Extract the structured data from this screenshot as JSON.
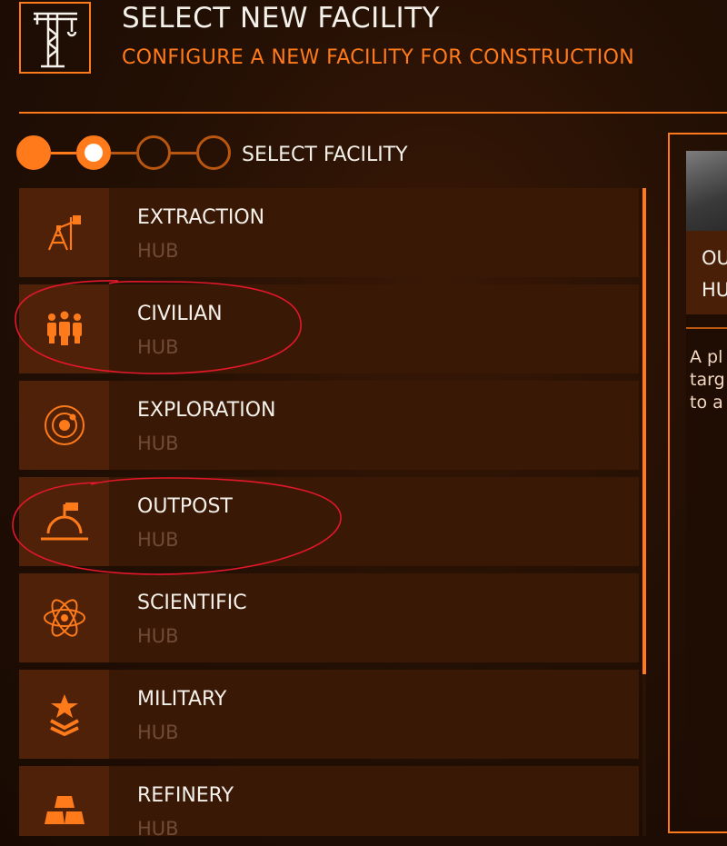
{
  "header": {
    "title": "SELECT NEW FACILITY",
    "subtitle": "CONFIGURE A NEW FACILITY FOR CONSTRUCTION",
    "icon": "construction-crane-icon"
  },
  "steps": {
    "label": "SELECT FACILITY",
    "total": 4,
    "current": 2
  },
  "facilities": [
    {
      "name": "EXTRACTION",
      "type": "HUB",
      "icon": "oil-pump-icon"
    },
    {
      "name": "CIVILIAN",
      "type": "HUB",
      "icon": "people-icon"
    },
    {
      "name": "EXPLORATION",
      "type": "HUB",
      "icon": "orbit-icon"
    },
    {
      "name": "OUTPOST",
      "type": "HUB",
      "icon": "flag-dome-icon"
    },
    {
      "name": "SCIENTIFIC",
      "type": "HUB",
      "icon": "atom-icon"
    },
    {
      "name": "MILITARY",
      "type": "HUB",
      "icon": "star-chevron-icon"
    },
    {
      "name": "REFINERY",
      "type": "HUB",
      "icon": "ingots-icon"
    }
  ],
  "detail": {
    "title_line1": "OU",
    "title_line2": "HU",
    "description": "A pl\ntarg\nto a"
  },
  "colors": {
    "accent": "#ff7a1a",
    "row_bg": "#3a1806",
    "icon_bg": "#4e2108",
    "sub_text": "#6f4a34",
    "annotation": "#e4172b"
  },
  "annotations": [
    "CIVILIAN",
    "OUTPOST"
  ]
}
